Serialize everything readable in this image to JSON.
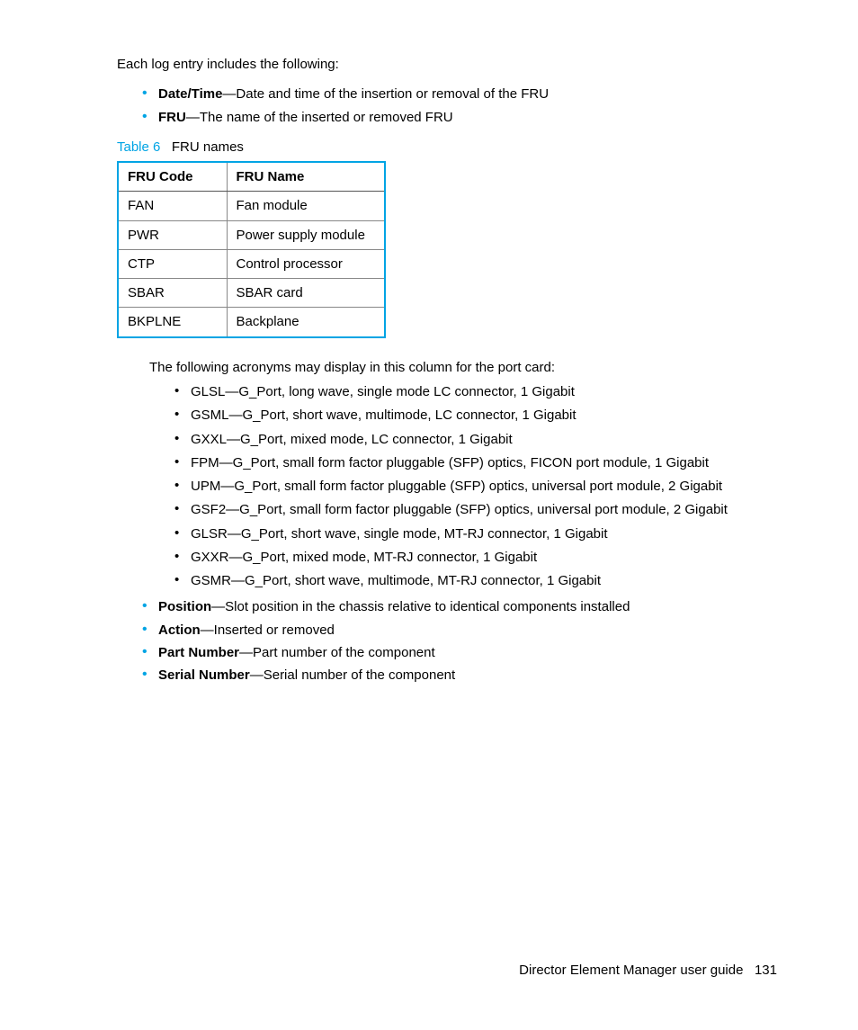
{
  "intro": "Each log entry includes the following:",
  "log_fields_top": [
    {
      "term": "Date/Time",
      "def": "—Date and time of the insertion or removal of the FRU"
    },
    {
      "term": "FRU",
      "def": "—The name of the inserted or removed FRU"
    }
  ],
  "table": {
    "caption_label": "Table 6",
    "caption_text": "FRU names",
    "headers": [
      "FRU Code",
      "FRU Name"
    ],
    "rows": [
      [
        "FAN",
        "Fan module"
      ],
      [
        "PWR",
        "Power supply module"
      ],
      [
        "CTP",
        "Control processor"
      ],
      [
        "SBAR",
        "SBAR card"
      ],
      [
        "BKPLNE",
        "Backplane"
      ]
    ]
  },
  "acronym_intro": "The following acronyms may display in this column for the port card:",
  "acronyms": [
    "GLSL—G_Port, long wave, single mode LC connector, 1 Gigabit",
    "GSML—G_Port, short wave, multimode, LC connector, 1 Gigabit",
    "GXXL—G_Port, mixed mode, LC connector, 1 Gigabit",
    "FPM—G_Port, small form factor pluggable (SFP) optics, FICON port module, 1 Gigabit",
    "UPM—G_Port, small form factor pluggable (SFP) optics, universal port module, 2 Gigabit",
    "GSF2—G_Port, small form factor pluggable (SFP) optics, universal port module, 2 Gigabit",
    "GLSR—G_Port, short wave, single mode, MT-RJ connector, 1 Gigabit",
    "GXXR—G_Port, mixed mode, MT-RJ connector, 1 Gigabit",
    "GSMR—G_Port, short wave, multimode, MT-RJ connector, 1 Gigabit"
  ],
  "log_fields_bottom": [
    {
      "term": "Position",
      "def": "—Slot position in the chassis relative to identical components installed"
    },
    {
      "term": "Action",
      "def": "—Inserted or removed"
    },
    {
      "term": "Part Number",
      "def": "—Part number of the component"
    },
    {
      "term": "Serial Number",
      "def": "—Serial number of the component"
    }
  ],
  "footer": {
    "title": "Director Element Manager user guide",
    "page": "131"
  }
}
